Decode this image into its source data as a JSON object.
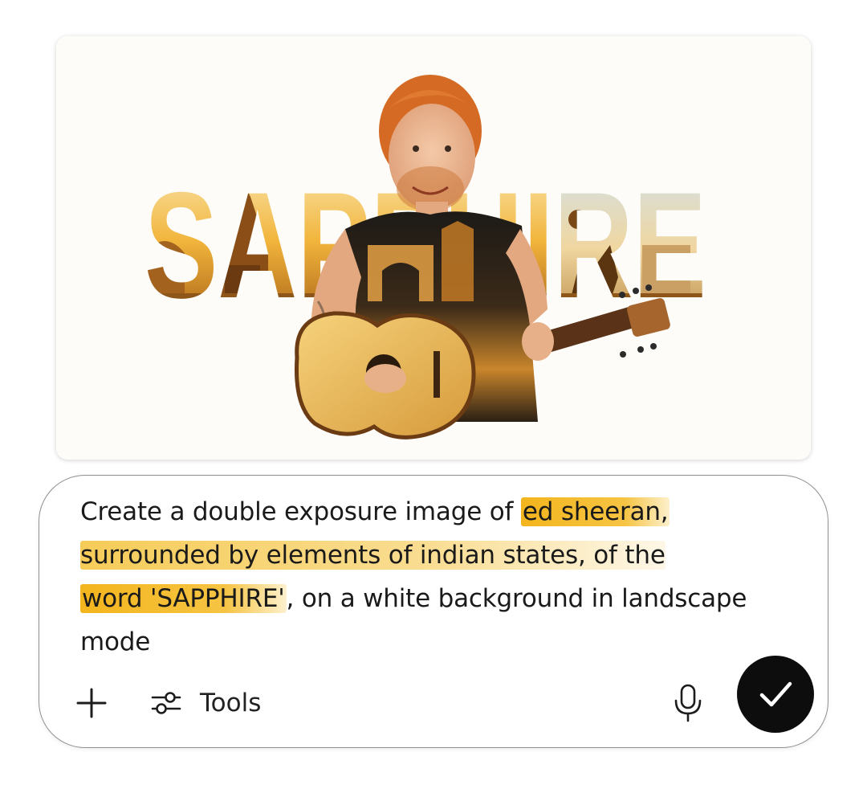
{
  "generated_image": {
    "word": "SAPPHIRE"
  },
  "composer": {
    "prompt_plain_1": "Create a double exposure image of ",
    "prompt_hl_1": "ed sheeran,",
    "prompt_hl_2": "surrounded by elements of indian states, of the",
    "prompt_hl_3": "word 'SAPPHIRE'",
    "prompt_plain_2": ", on a white background in landscape mode",
    "tools_label": "Tools"
  },
  "icons": {
    "plus": "plus-icon",
    "tools": "sliders-icon",
    "mic": "microphone-icon",
    "submit": "checkmark-icon"
  },
  "colors": {
    "highlight": "#f3b51d",
    "submit_bg": "#0d0d0d",
    "accent_warm": "#e9a62a"
  }
}
